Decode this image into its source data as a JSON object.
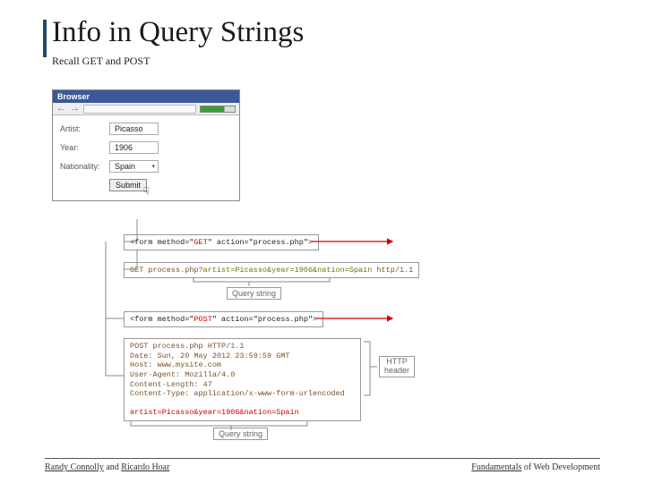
{
  "title": "Info in Query Strings",
  "subtitle": "Recall GET and POST",
  "browser": {
    "titlebar": "Browser",
    "form": {
      "artist_label": "Artist:",
      "artist_value": "Picasso",
      "year_label": "Year:",
      "year_value": "1906",
      "nationality_label": "Nationality:",
      "nationality_value": "Spain",
      "submit": "Submit"
    }
  },
  "form_get": {
    "prefix": "<form method=\"",
    "method": "GET",
    "suffix": "\" action=\"process.php\">"
  },
  "get_request": {
    "verb": "GET ",
    "path": "process.php?",
    "query": "artist=Picasso&year=1906&nation=Spain",
    "protocol": " http/1.1"
  },
  "form_post": {
    "prefix": "<form method=\"",
    "method": "POST",
    "suffix": "\" action=\"process.php\">"
  },
  "post_request": {
    "line1": "POST process.php HTTP/1.1",
    "line2": "Date: Sun, 20 May 2012 23:59:59 GMT",
    "line3": "Host: www.mysite.com",
    "line4": "User-Agent: Mozilla/4.0",
    "line5": "Content-Length: 47",
    "line6": "Content-Type: application/x-www-form-urlencoded",
    "body": "artist=Picasso&year=1906&nation=Spain"
  },
  "labels": {
    "query_string": "Query string",
    "http_header": "HTTP\nheader"
  },
  "footer": {
    "author1": "Randy Connolly",
    "and": " and ",
    "author2": "Ricardo Hoar",
    "book_u": "Fundamentals",
    "book_rest": " of Web Development"
  }
}
